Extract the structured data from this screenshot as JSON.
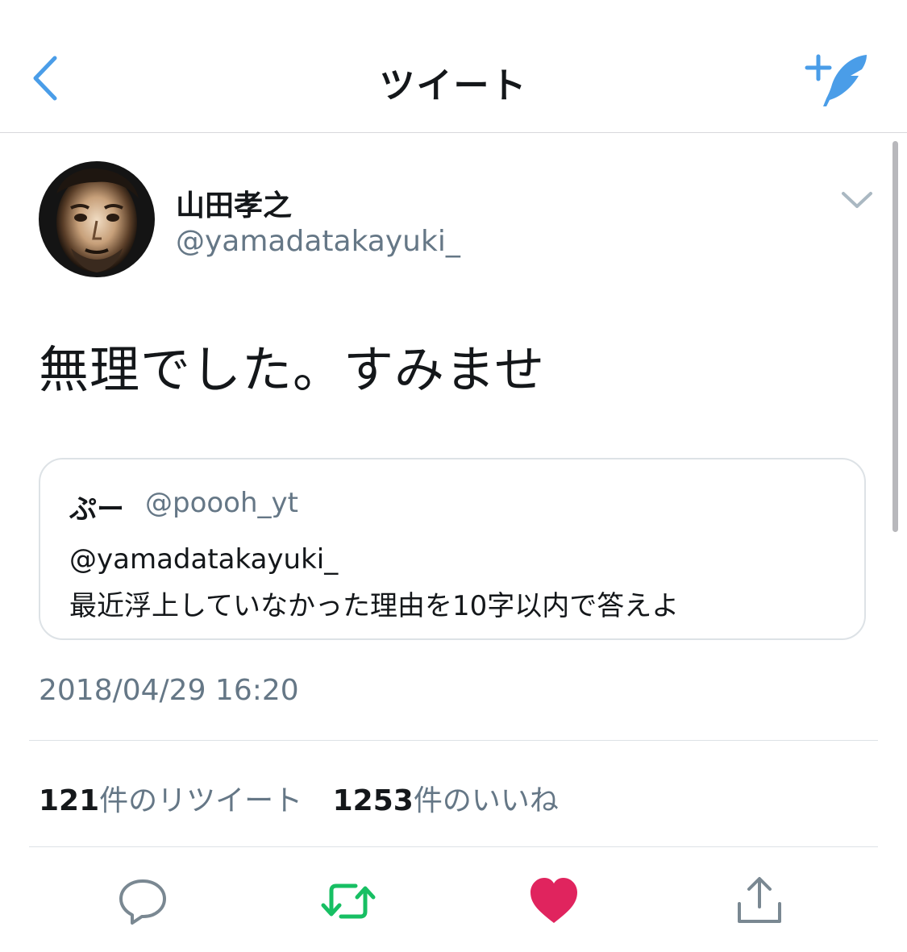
{
  "nav": {
    "title": "ツイート",
    "back_icon": "chevron-left-icon",
    "compose_icon": "compose-feather-icon"
  },
  "tweet": {
    "author": {
      "display_name": "山田孝之",
      "handle": "@yamadatakayuki_"
    },
    "text": "無理でした。すみませ",
    "timestamp": "2018/04/29 16:20",
    "quote": {
      "display_name": "ぷー",
      "handle": "@poooh_yt",
      "line1": "@yamadatakayuki_",
      "line2": "最近浮上していなかった理由を10字以内で答えよ"
    },
    "stats": {
      "retweets_count": "121",
      "retweets_label": "件のリツイート",
      "likes_count": "1253",
      "likes_label": "件のいいね"
    }
  },
  "actions": {
    "reply_icon": "reply-icon",
    "retweet_icon": "retweet-icon",
    "like_icon": "heart-icon",
    "share_icon": "share-icon"
  },
  "colors": {
    "accent": "#4a9de8",
    "retweet": "#17bf63",
    "like": "#e0245e",
    "secondary_text": "#657786",
    "action_gray": "#7a8892"
  }
}
